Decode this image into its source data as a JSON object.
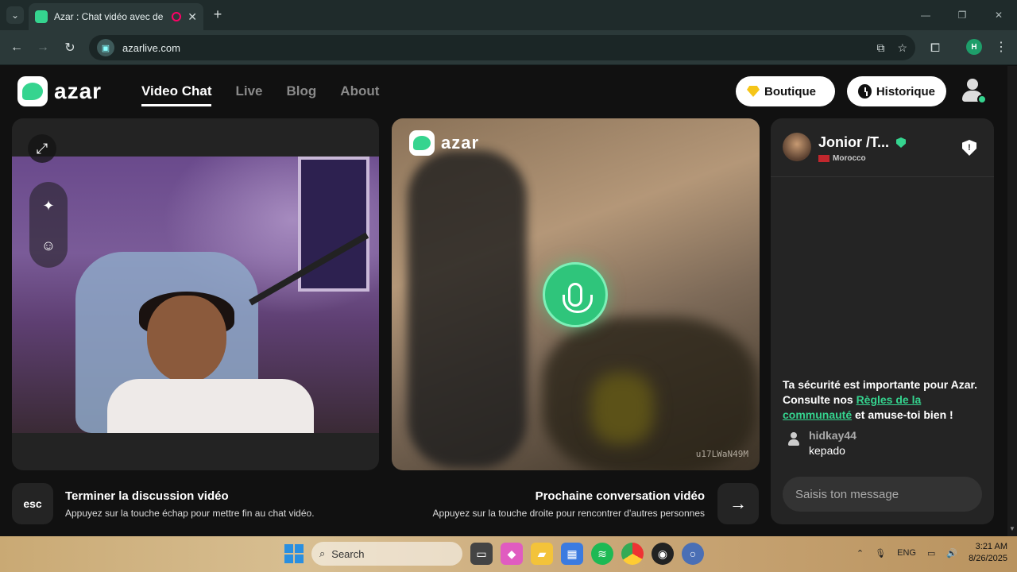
{
  "browser": {
    "tab_title": "Azar : Chat vidéo avec de no",
    "url": "azarlive.com",
    "profile_initial": "H"
  },
  "site": {
    "logo_text": "azar",
    "nav": [
      {
        "label": "Video Chat",
        "active": true
      },
      {
        "label": "Live",
        "active": false
      },
      {
        "label": "Blog",
        "active": false
      },
      {
        "label": "About",
        "active": false
      }
    ],
    "boutique_label": "Boutique",
    "historique_label": "Historique"
  },
  "video": {
    "center_logo_text": "azar",
    "peer_code": "u17LWaN49M"
  },
  "peer": {
    "name": "Jonior /T...",
    "country": "Morocco"
  },
  "chat": {
    "safety_prefix": "Ta sécurité est importante pour Azar. Consulte nos ",
    "safety_link": "Règles de la communauté",
    "safety_suffix": " et amuse-toi bien !",
    "messages": [
      {
        "user": "hidkay44",
        "text": "kepado"
      }
    ],
    "input_placeholder": "Saisis ton message"
  },
  "hints": {
    "esc_key": "esc",
    "end_title": "Terminer la discussion vidéo",
    "end_sub": "Appuyez sur la touche échap pour mettre fin au chat vidéo.",
    "next_title": "Prochaine conversation vidéo",
    "next_sub": "Appuyez sur la touche droite pour rencontrer d'autres personnes"
  },
  "taskbar": {
    "search_label": "Search",
    "language": "ENG",
    "time": "3:21 AM",
    "date": "8/26/2025"
  },
  "colors": {
    "accent": "#35d48f",
    "page_bg": "#111111",
    "panel_bg": "#242424"
  }
}
